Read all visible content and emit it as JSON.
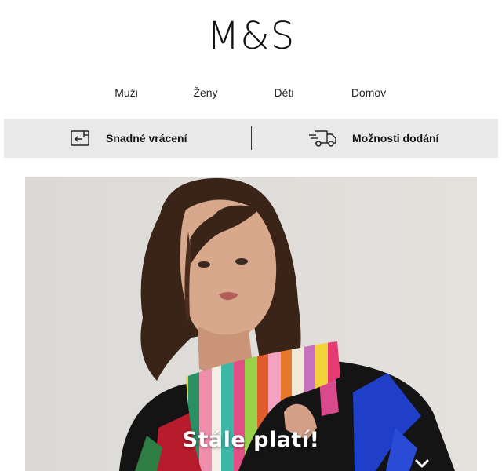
{
  "brand": {
    "logo_text": "M&S"
  },
  "nav": {
    "items": [
      {
        "label": "Muži"
      },
      {
        "label": "Ženy"
      },
      {
        "label": "Děti"
      },
      {
        "label": "Domov"
      }
    ]
  },
  "services": {
    "returns": {
      "label": "Snadné vrácení",
      "icon": "return-box-icon"
    },
    "delivery": {
      "label": "Možnosti dodání",
      "icon": "delivery-truck-icon"
    }
  },
  "hero": {
    "title": "Stále platí!",
    "icon": "chevron-down-icon",
    "image": "model-with-colorful-striped-scarf"
  },
  "colors": {
    "strip_bg": "#e9e9e9",
    "text": "#111111",
    "hero_text": "#ffffff"
  }
}
